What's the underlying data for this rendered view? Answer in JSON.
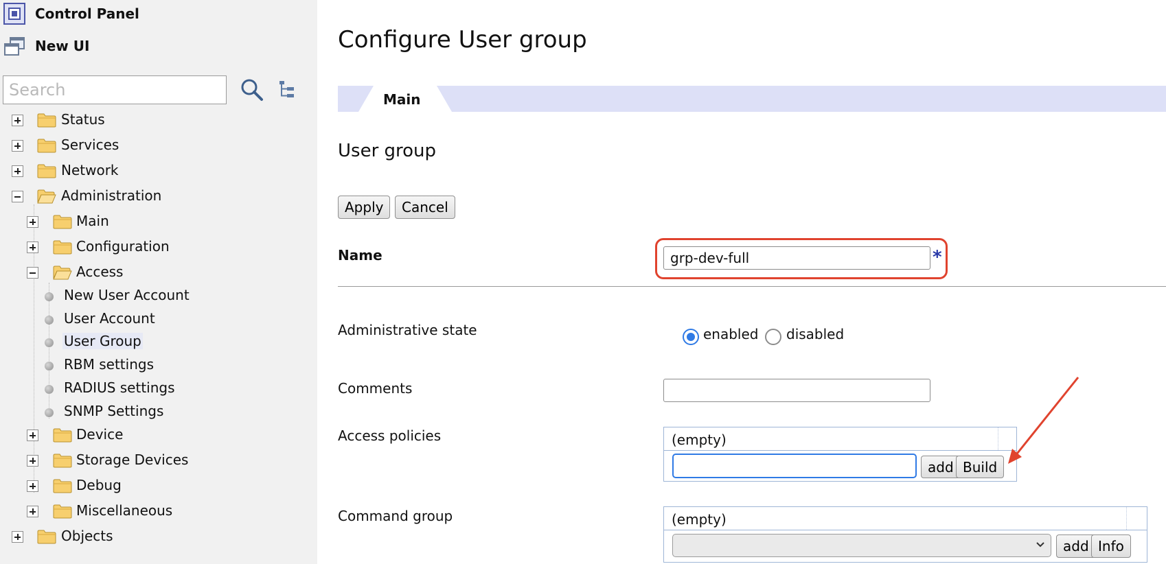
{
  "sidebar": {
    "control_panel": "Control Panel",
    "new_ui": "New UI",
    "search_placeholder": "Search",
    "tree": {
      "status": "Status",
      "services": "Services",
      "network": "Network",
      "administration": "Administration",
      "main": "Main",
      "configuration": "Configuration",
      "access": "Access",
      "leaves": [
        "New User Account",
        "User Account",
        "User Group",
        "RBM settings",
        "RADIUS settings",
        "SNMP Settings"
      ],
      "device": "Device",
      "storage_devices": "Storage Devices",
      "debug": "Debug",
      "miscellaneous": "Miscellaneous",
      "objects": "Objects"
    },
    "selected_item": "User Group"
  },
  "main": {
    "title": "Configure User group",
    "tab": "Main",
    "section_title": "User group",
    "apply": "Apply",
    "cancel": "Cancel",
    "name_label": "Name",
    "name_value": "grp-dev-full",
    "required_marker": "*",
    "admin_state_label": "Administrative state",
    "admin_state": {
      "enabled": "enabled",
      "disabled": "disabled",
      "selected": "enabled"
    },
    "comments_label": "Comments",
    "comments_value": "",
    "access_policies_label": "Access policies",
    "access_policies_empty": "(empty)",
    "access_add": "add",
    "access_build": "Build",
    "command_group_label": "Command group",
    "command_group_empty": "(empty)",
    "command_add": "add",
    "command_info": "Info"
  },
  "colors": {
    "sidebar_bg": "#f1f1f1",
    "tabbar_bg": "#dde0f7",
    "highlight": "#e0432e",
    "accent": "#2f7ae5",
    "required": "#2a3aa8"
  }
}
